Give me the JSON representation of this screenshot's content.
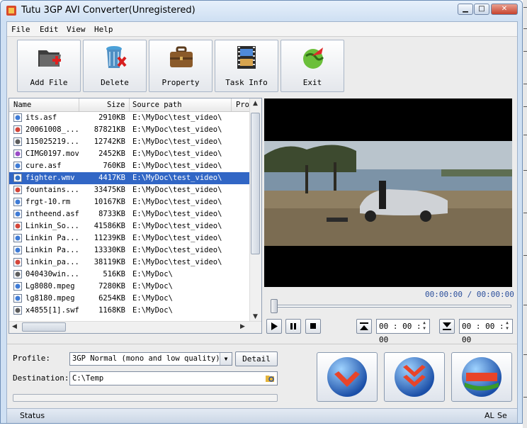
{
  "window": {
    "title": "Tutu 3GP AVI Converter(Unregistered)"
  },
  "menu": [
    "File",
    "Edit",
    "View",
    "Help"
  ],
  "toolbar": [
    {
      "label": "Add File",
      "icon": "add-file-icon"
    },
    {
      "label": "Delete",
      "icon": "trash-icon"
    },
    {
      "label": "Property",
      "icon": "briefcase-icon"
    },
    {
      "label": "Task Info",
      "icon": "film-info-icon"
    },
    {
      "label": "Exit",
      "icon": "exit-globe-icon"
    }
  ],
  "filelist": {
    "columns": [
      "Name",
      "Size",
      "Source path",
      "Pro"
    ],
    "rows": [
      {
        "name": "its.asf",
        "size": "2910KB",
        "path": "E:\\MyDoc\\test_video\\"
      },
      {
        "name": "20061008_...",
        "size": "87821KB",
        "path": "E:\\MyDoc\\test_video\\"
      },
      {
        "name": "115025219...",
        "size": "12742KB",
        "path": "E:\\MyDoc\\test_video\\"
      },
      {
        "name": "CIMG0197.mov",
        "size": "2452KB",
        "path": "E:\\MyDoc\\test_video\\"
      },
      {
        "name": "cure.asf",
        "size": "760KB",
        "path": "E:\\MyDoc\\test_video\\"
      },
      {
        "name": "fighter.wmv",
        "size": "4417KB",
        "path": "E:\\MyDoc\\test_video\\"
      },
      {
        "name": "fountains...",
        "size": "33475KB",
        "path": "E:\\MyDoc\\test_video\\"
      },
      {
        "name": "frgt-10.rm",
        "size": "10167KB",
        "path": "E:\\MyDoc\\test_video\\"
      },
      {
        "name": "intheend.asf",
        "size": "8733KB",
        "path": "E:\\MyDoc\\test_video\\"
      },
      {
        "name": "Linkin_So...",
        "size": "41586KB",
        "path": "E:\\MyDoc\\test_video\\"
      },
      {
        "name": "Linkin Pa...",
        "size": "11239KB",
        "path": "E:\\MyDoc\\test_video\\"
      },
      {
        "name": "Linkin Pa...",
        "size": "13330KB",
        "path": "E:\\MyDoc\\test_video\\"
      },
      {
        "name": "linkin_pa...",
        "size": "38119KB",
        "path": "E:\\MyDoc\\test_video\\"
      },
      {
        "name": "040430win...",
        "size": "516KB",
        "path": "E:\\MyDoc\\"
      },
      {
        "name": "Lg8080.mpeg",
        "size": "7280KB",
        "path": "E:\\MyDoc\\"
      },
      {
        "name": "lg8180.mpeg",
        "size": "6254KB",
        "path": "E:\\MyDoc\\"
      },
      {
        "name": "x4855[1].swf",
        "size": "1168KB",
        "path": "E:\\MyDoc\\"
      }
    ],
    "selected_row": "fighter.wmv"
  },
  "player": {
    "time": "00:00:00 / 00:00:00",
    "start_time": "00 : 00 : 00",
    "end_time": "00 : 00 : 00"
  },
  "profile": {
    "label": "Profile:",
    "value": "3GP Normal (mono and low quality)(*.3gp)",
    "detail_label": "Detail"
  },
  "destination": {
    "label": "Destination:",
    "value": "C:\\Temp"
  },
  "status": {
    "text": "Status",
    "right1": "AL",
    "right2": "Se"
  },
  "colors": {
    "selection": "#3166c5",
    "title_bg": "#cfe0f3",
    "time_text": "#2b4f9c"
  }
}
